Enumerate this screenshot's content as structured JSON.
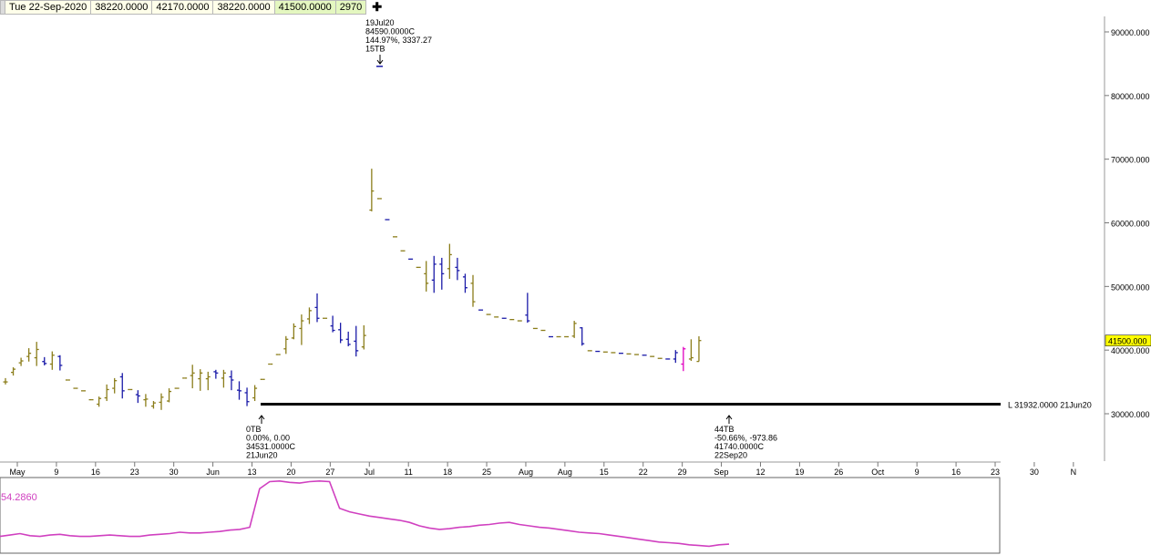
{
  "toolbar": {
    "date": "Tue 22-Sep-2020",
    "open": "38220.0000",
    "high": "42170.0000",
    "low": "38220.0000",
    "close": "41500.0000",
    "volume": "2970",
    "add_symbol": "✚"
  },
  "chart_data": [
    {
      "type": "ohlc",
      "y_ticks": [
        "90000.000",
        "80000.000",
        "70000.000",
        "60000.000",
        "50000.000",
        "40000.000",
        "30000.000"
      ],
      "ylim": [
        21000,
        94500
      ],
      "x_tick_labels": [
        "May",
        "9",
        "16",
        "23",
        "30",
        "Jun",
        "13",
        "20",
        "27",
        "Jul",
        "11",
        "18",
        "25",
        "Aug",
        "Aug",
        "15",
        "22",
        "29",
        "Sep",
        "12",
        "19",
        "26",
        "Oct",
        "9",
        "16",
        "23",
        "30",
        "N"
      ],
      "last_price_label": "41500.000",
      "last_price": 41500,
      "support_line": {
        "value": 31932,
        "label": "L 31932.0000 21Jun20"
      },
      "annotations": [
        {
          "name": "peak",
          "date_index": 33,
          "price": 84590,
          "arrow": "down",
          "lines": [
            "19Jul20",
            "84590.0000C",
            "144.97%, 3337.27",
            "15TB"
          ]
        },
        {
          "name": "low",
          "date_index": 18,
          "price": 31932,
          "arrow": "up",
          "lines": [
            "0TB",
            "0.00%, 0.00",
            "34531.0000C",
            "21Jun20"
          ]
        },
        {
          "name": "last",
          "date_index": 62,
          "price": 38220,
          "arrow": "up",
          "lines": [
            "44TB",
            "-50.66%, -973.86",
            "41740.0000C",
            "22Sep20"
          ]
        }
      ],
      "bars": [
        {
          "o": 35000,
          "h": 35600,
          "l": 34600,
          "c": 35000
        },
        {
          "o": 36500,
          "h": 37300,
          "l": 36000,
          "c": 37000
        },
        {
          "o": 38000,
          "h": 38800,
          "l": 37500,
          "c": 38300
        },
        {
          "o": 39000,
          "h": 40300,
          "l": 38200,
          "c": 39500
        },
        {
          "o": 38800,
          "h": 41300,
          "l": 37500,
          "c": 40100
        },
        {
          "o": 38200,
          "h": 38900,
          "l": 37600,
          "c": 37900
        },
        {
          "o": 37800,
          "h": 39800,
          "l": 36900,
          "c": 39200
        },
        {
          "o": 39000,
          "h": 39200,
          "l": 36800,
          "c": 37600
        },
        {
          "o": 35300,
          "h": 35300,
          "l": 35300,
          "c": 35300
        },
        {
          "o": 34000,
          "h": 34000,
          "l": 34000,
          "c": 34000
        },
        {
          "o": 33600,
          "h": 33600,
          "l": 33600,
          "c": 33600
        },
        {
          "o": 32200,
          "h": 32200,
          "l": 32200,
          "c": 32200
        },
        {
          "o": 31500,
          "h": 32700,
          "l": 31100,
          "c": 32400
        },
        {
          "o": 32500,
          "h": 34600,
          "l": 32000,
          "c": 33800
        },
        {
          "o": 34000,
          "h": 35600,
          "l": 33200,
          "c": 35200
        },
        {
          "o": 35800,
          "h": 36400,
          "l": 32400,
          "c": 33600
        },
        {
          "o": 33800,
          "h": 33800,
          "l": 33800,
          "c": 33800
        },
        {
          "o": 33000,
          "h": 33700,
          "l": 31700,
          "c": 32800
        },
        {
          "o": 32200,
          "h": 33100,
          "l": 31100,
          "c": 32300
        },
        {
          "o": 31200,
          "h": 32000,
          "l": 30800,
          "c": 31700
        },
        {
          "o": 31800,
          "h": 33200,
          "l": 30600,
          "c": 32600
        },
        {
          "o": 32000,
          "h": 34000,
          "l": 31800,
          "c": 33500
        },
        {
          "o": 34000,
          "h": 34000,
          "l": 34000,
          "c": 34000
        },
        {
          "o": 35600,
          "h": 35600,
          "l": 35600,
          "c": 35600
        },
        {
          "o": 36000,
          "h": 37700,
          "l": 34000,
          "c": 36400
        },
        {
          "o": 35500,
          "h": 37000,
          "l": 33600,
          "c": 36400
        },
        {
          "o": 35500,
          "h": 36600,
          "l": 33700,
          "c": 35800
        },
        {
          "o": 36600,
          "h": 36900,
          "l": 35500,
          "c": 36400
        },
        {
          "o": 35600,
          "h": 36900,
          "l": 34100,
          "c": 36400
        },
        {
          "o": 35800,
          "h": 36800,
          "l": 33700,
          "c": 35300
        },
        {
          "o": 33700,
          "h": 35100,
          "l": 32200,
          "c": 33600
        },
        {
          "o": 33300,
          "h": 34100,
          "l": 31200,
          "c": 31900
        },
        {
          "o": 32500,
          "h": 34500,
          "l": 32000,
          "c": 34000
        },
        {
          "o": 35400,
          "h": 35400,
          "l": 35400,
          "c": 35400
        },
        {
          "o": 37800,
          "h": 37800,
          "l": 37800,
          "c": 37800
        },
        {
          "o": 39300,
          "h": 39300,
          "l": 39300,
          "c": 39300
        },
        {
          "o": 40200,
          "h": 42200,
          "l": 39400,
          "c": 41700
        },
        {
          "o": 41900,
          "h": 44200,
          "l": 41700,
          "c": 43700
        },
        {
          "o": 43400,
          "h": 45600,
          "l": 40800,
          "c": 44600
        },
        {
          "o": 44900,
          "h": 46700,
          "l": 44100,
          "c": 46200
        },
        {
          "o": 46700,
          "h": 48900,
          "l": 44400,
          "c": 45000
        },
        {
          "o": 45000,
          "h": 45000,
          "l": 45000,
          "c": 45000
        },
        {
          "o": 43800,
          "h": 45400,
          "l": 42800,
          "c": 43100
        },
        {
          "o": 43200,
          "h": 44300,
          "l": 41100,
          "c": 41600
        },
        {
          "o": 41700,
          "h": 42900,
          "l": 40600,
          "c": 40900
        },
        {
          "o": 41400,
          "h": 43800,
          "l": 39000,
          "c": 39900
        },
        {
          "o": 40500,
          "h": 43900,
          "l": 40100,
          "c": 42300
        },
        {
          "o": 62000,
          "h": 68500,
          "l": 61800,
          "c": 65000
        },
        {
          "o": 63800,
          "h": 63800,
          "l": 63800,
          "c": 63800
        }
      ]
    },
    {
      "type": "line",
      "name": "indicator",
      "value_label": "54.2860",
      "values": [
        20,
        22,
        24,
        21,
        20,
        22,
        23,
        21,
        20,
        20,
        21,
        22,
        21,
        20,
        20,
        22,
        23,
        24,
        26,
        25,
        25,
        26,
        27,
        29,
        30,
        33,
        88,
        98,
        99,
        97,
        96,
        98,
        99,
        98,
        60,
        55,
        52,
        49,
        47,
        45,
        43,
        40,
        35,
        32,
        30,
        31,
        33,
        34,
        36,
        37,
        39,
        40,
        37,
        35,
        33,
        32,
        30,
        28,
        26,
        25,
        24,
        22,
        20,
        18,
        16,
        14,
        12,
        11,
        10,
        8,
        7,
        6,
        8,
        9
      ],
      "ylim": [
        0,
        100
      ]
    }
  ]
}
